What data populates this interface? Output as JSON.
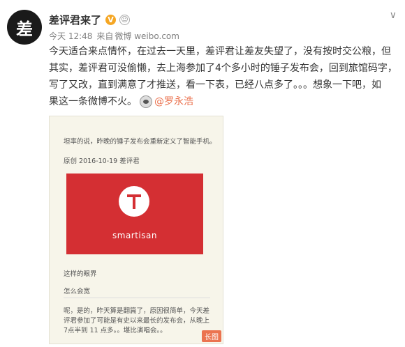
{
  "author": {
    "avatar_char": "差",
    "name": "差评君来了",
    "verified_mark": "V",
    "member_icon_char": "☺"
  },
  "meta": {
    "time": "今天 12:48",
    "source_prefix": "来自",
    "source": "微博 weibo.com"
  },
  "post": {
    "line1": "今天适合来点情怀，在过去一天里，差评君让差友失望了，没有按时交公粮，但",
    "line2": "其实，差评君可没偷懒，去上海参加了4个多小时的锤子发布会，回到旅馆码字，",
    "line3": "写了又改，直到满意了才推送，看一下表，已经八点多了。。。想象一下吧，如",
    "line4_prefix": "果这一条微博不火。",
    "mention": "@罗永浩"
  },
  "long_image": {
    "text1": "坦率的说，昨晚的锤子发布会重新定义了智能手机。",
    "byline": "原创   2016-10-19  差评君",
    "logo_letter": "T",
    "logo_word": "smartisan",
    "text3": "这样的眼界",
    "text4": "怎么会宽",
    "text5": "呢，是的，昨天算是翻篇了，原因很简单，今天差评君参加了可能是有史以来最长的发布会，从晚上7点半到 11 点多。。堪比演唱会。。",
    "badge": "长图"
  },
  "ui": {
    "menu_arrow": "∨"
  },
  "colors": {
    "accent": "#eb7350",
    "brand_red": "#d42f33",
    "verified": "#f5a623"
  }
}
